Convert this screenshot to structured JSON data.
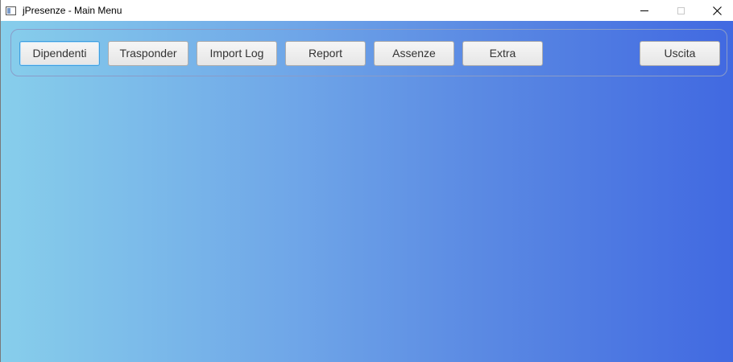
{
  "window": {
    "title": "jPresenze - Main Menu"
  },
  "toolbar": {
    "buttons": [
      {
        "label": "Dipendenti"
      },
      {
        "label": "Trasponder"
      },
      {
        "label": "Import Log"
      },
      {
        "label": "Report"
      },
      {
        "label": "Assenze"
      },
      {
        "label": "Extra"
      }
    ],
    "exit_label": "Uscita"
  },
  "colors": {
    "gradient_start": "#87ceeb",
    "gradient_end": "#4169e1",
    "focus_border": "#3c9ee0"
  },
  "icons": {
    "app": "app-icon",
    "minimize": "minimize-icon",
    "maximize": "maximize-icon",
    "close": "close-icon"
  }
}
